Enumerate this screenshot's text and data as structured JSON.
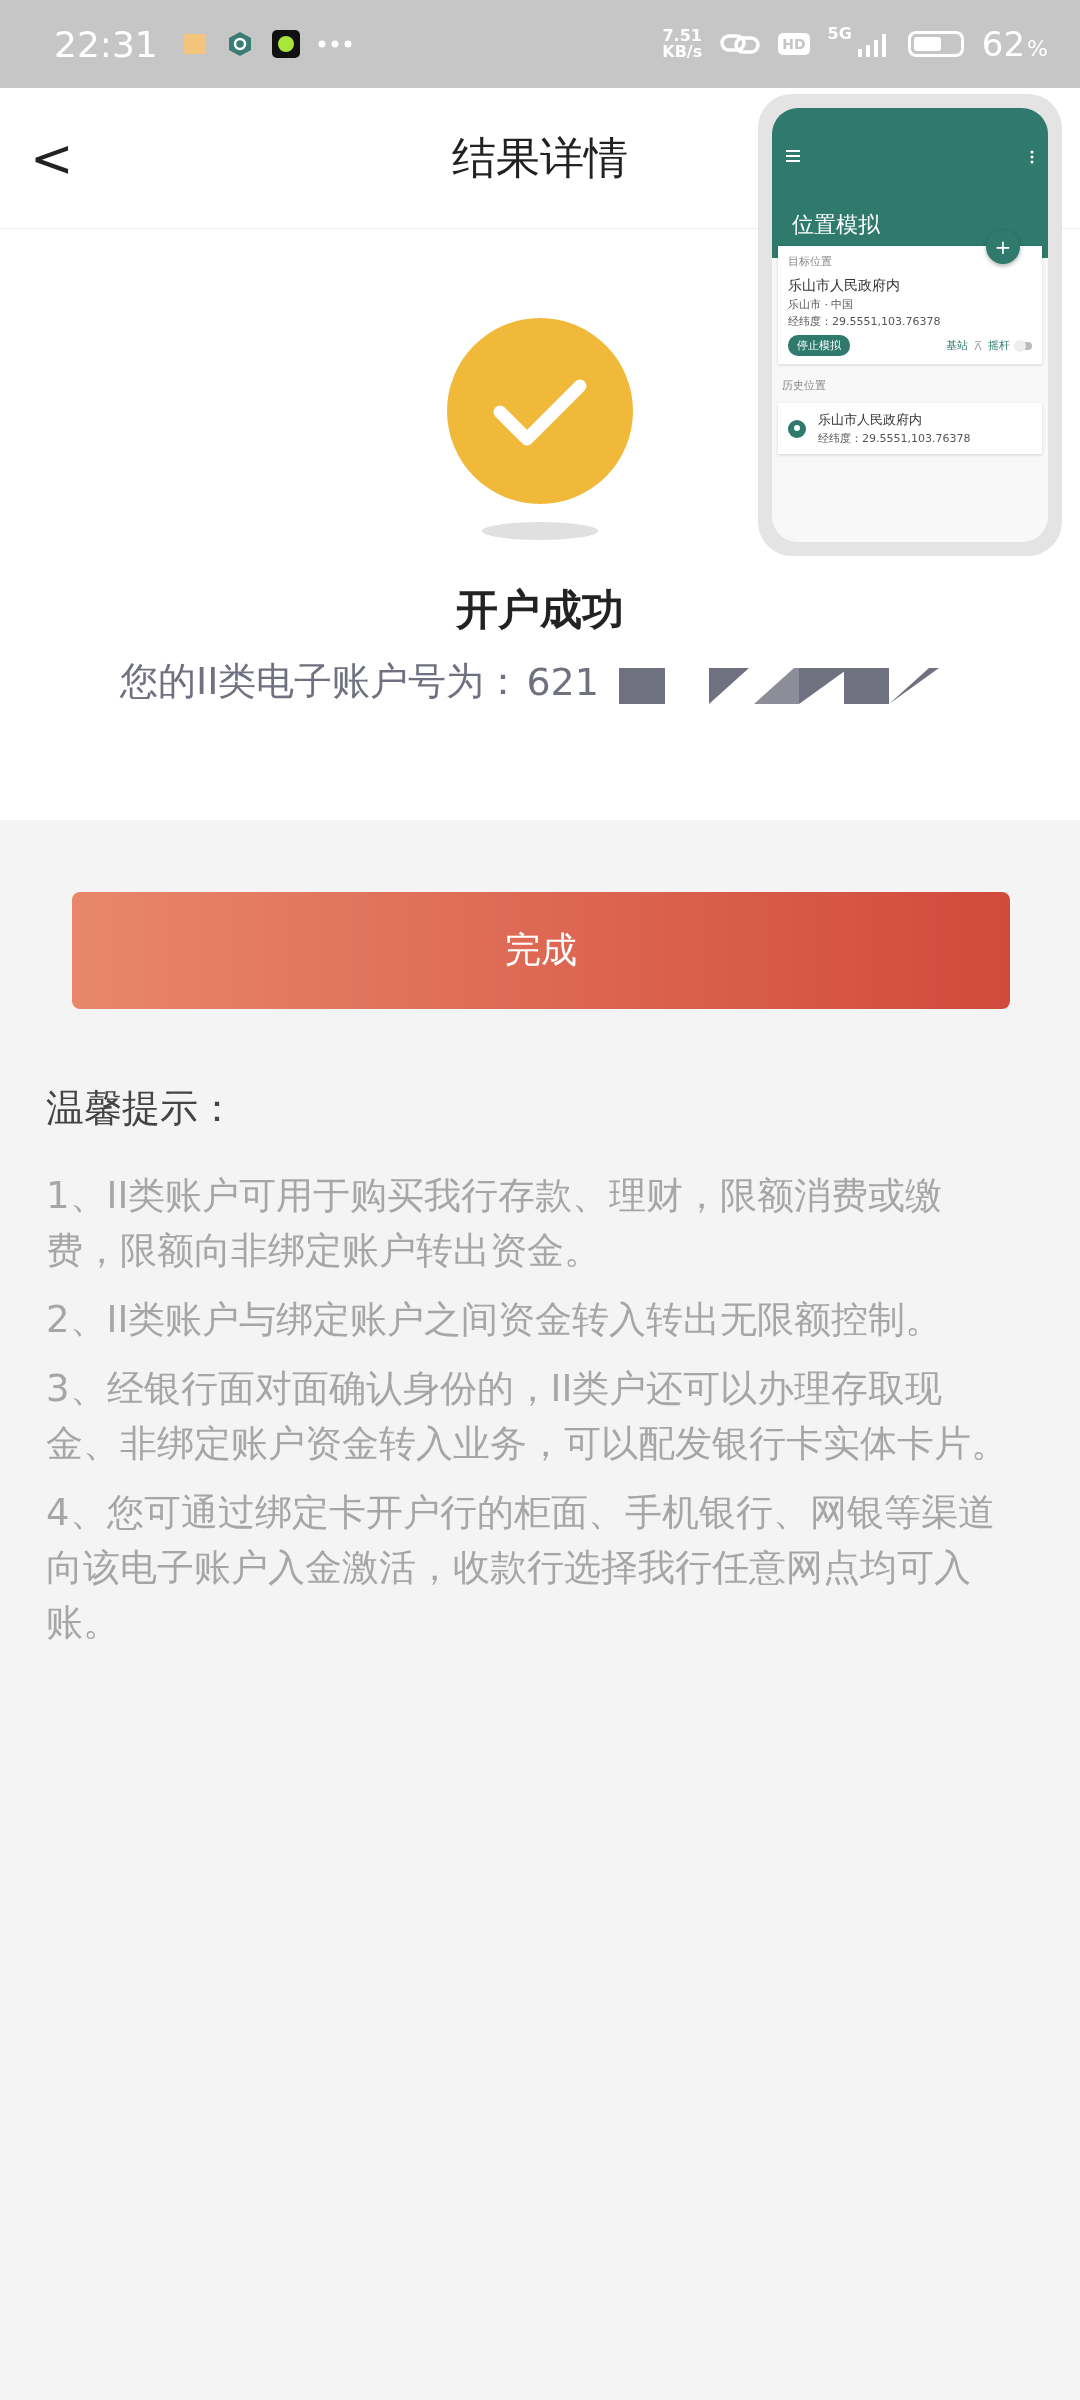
{
  "status_bar": {
    "time": "22:31",
    "speed_value": "7.51",
    "speed_unit": "KB/s",
    "hd": "HD",
    "network": "5G",
    "battery": "62",
    "battery_unit": "%"
  },
  "header": {
    "back": "<",
    "title": "结果详情"
  },
  "result": {
    "title": "开户成功",
    "account_label": "您的II类电子账户号为：",
    "account_visible": "621"
  },
  "done_button": "完成",
  "tips": {
    "title": "温馨提示：",
    "items": [
      "1、II类账户可用于购买我行存款、理财，限额消费或缴费，限额向非绑定账户转出资金。",
      "2、II类账户与绑定账户之间资金转入转出无限额控制。",
      "3、经银行面对面确认身份的，II类户还可以办理存取现金、非绑定账户资金转入业务，可以配发银行卡实体卡片。",
      "4、您可通过绑定卡开户行的柜面、手机银行、网银等渠道向该电子账户入金激活，收款行选择我行任意网点均可入账。"
    ]
  },
  "overlay": {
    "title": "位置模拟",
    "plus": "+",
    "target_label": "目标位置",
    "place": "乐山市人民政府内",
    "region": "乐山市 · 中国",
    "coords": "经纬度：29.5551,103.76378",
    "stop_button": "停止模拟",
    "base_station": "基站",
    "joystick": "摇杆",
    "joystick_on": false,
    "history_label": "历史位置",
    "history": [
      {
        "place": "乐山市人民政府内",
        "coords": "经纬度：29.5551,103.76378"
      }
    ]
  }
}
